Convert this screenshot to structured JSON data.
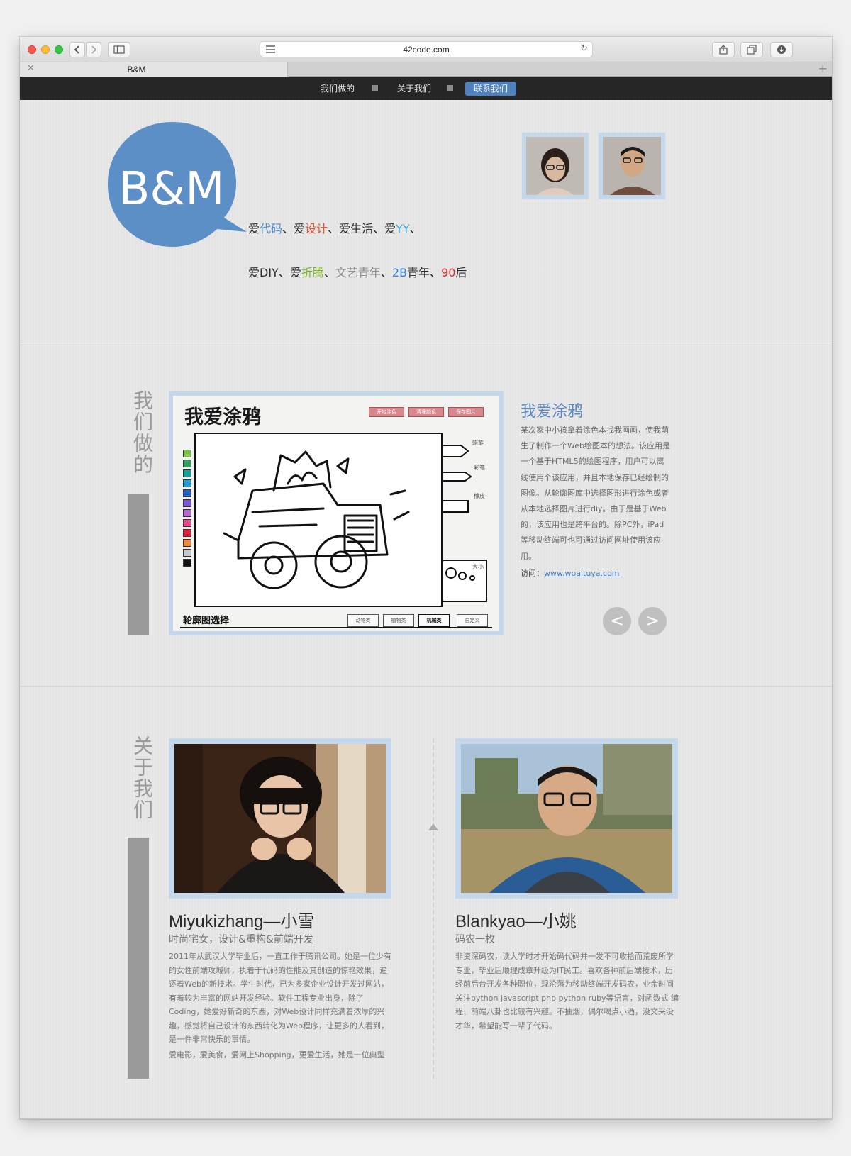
{
  "browser": {
    "url": "42code.com",
    "tab_title": "B&M"
  },
  "nav": {
    "items": [
      {
        "label": "我们做的"
      },
      {
        "label": "关于我们"
      },
      {
        "label": "联系我们"
      }
    ],
    "active_color": "#4f82bd"
  },
  "hero": {
    "logo_text": "B&M",
    "logo_color": "#5b8fc6",
    "slogan_line1": [
      {
        "text": "爱",
        "color": "#2b2b2b"
      },
      {
        "text": "代码",
        "color": "#4f8fd0"
      },
      {
        "text": "、爱",
        "color": "#2b2b2b"
      },
      {
        "text": "设计",
        "color": "#e8542f"
      },
      {
        "text": "、爱生活、爱",
        "color": "#2b2b2b"
      },
      {
        "text": "YY",
        "color": "#3ab0e0"
      },
      {
        "text": "、",
        "color": "#2b2b2b"
      }
    ],
    "slogan_line2": [
      {
        "text": "爱DIY、爱",
        "color": "#2b2b2b"
      },
      {
        "text": "折腾",
        "color": "#79b52a"
      },
      {
        "text": "、",
        "color": "#2b2b2b"
      },
      {
        "text": "文艺青年",
        "color": "#8a8a8a"
      },
      {
        "text": "、",
        "color": "#2b2b2b"
      },
      {
        "text": "2B",
        "color": "#2f7fd8"
      },
      {
        "text": "青年、",
        "color": "#2b2b2b"
      },
      {
        "text": "90",
        "color": "#d8302a"
      },
      {
        "text": "后",
        "color": "#2b2b2b"
      }
    ]
  },
  "works": {
    "section_label": "我们做的",
    "app": {
      "title": "我爱涂鸦",
      "buttons": [
        "开始涂色",
        "清理颜色",
        "保存图片"
      ],
      "tool_labels": [
        "蜡笔",
        "彩笔",
        "橡皮",
        "大小"
      ],
      "outline_label": "轮廓图选择",
      "outline_tabs": [
        "动物类",
        "植物类",
        "机械类",
        "自定义"
      ]
    },
    "title": "我爱涂鸦",
    "description": "某次家中小孩拿着涂色本找我画画，使我萌生了制作一个Web绘图本的想法。该应用是一个基于HTML5的绘图程序，用户可以离线使用个该应用，并且本地保存已经绘制的图像。从轮廓图库中选择图形进行涂色或者从本地选择图片进行diy。由于是基于Web的，该应用也是跨平台的。除PC外，iPad等移动终端可也可通过访问网址使用该应用。",
    "visit_label": "访问：",
    "visit_link": "www.woaituya.com",
    "prev": "<",
    "next": ">"
  },
  "about": {
    "section_label": "关于我们",
    "people": [
      {
        "name": "Miyukizhang—小雪",
        "role": "时尚宅女，设计&重构&前端开发",
        "bio": "2011年从武汉大学毕业后，一直工作于腾讯公司。她是一位少有的女性前端攻城师，执着于代码的性能及其创造的惊艳效果，追逐着Web的新技术。学生时代，已为多家企业设计开发过网站，有着较为丰富的网站开发经验。软件工程专业出身，除了Coding，她爱好新奇的东西，对Web设计同样充满着浓厚的兴趣，感觉将自己设计的东西转化为Web程序，让更多的人看到，是一件非常快乐的事情。",
        "bio2": "爱电影，爱美食，爱网上Shopping，更爱生活，她是一位典型"
      },
      {
        "name": "Blankyao—小姚",
        "role": "码农一枚",
        "bio": "非资深码农，读大学时才开始码代码并一发不可收拾而荒废所学专业，毕业后顺理成章升级为IT民工。喜欢各种前后端技术，历经前后台开发各种职位，现沦落为移动终端开发码农，业余时间关注python javascript php python ruby等语言，对函数式 编程、前端八卦也比较有兴趣。不抽烟，偶尔喝点小酒，没文采没才华，希望能写一辈子代码。"
      }
    ]
  }
}
